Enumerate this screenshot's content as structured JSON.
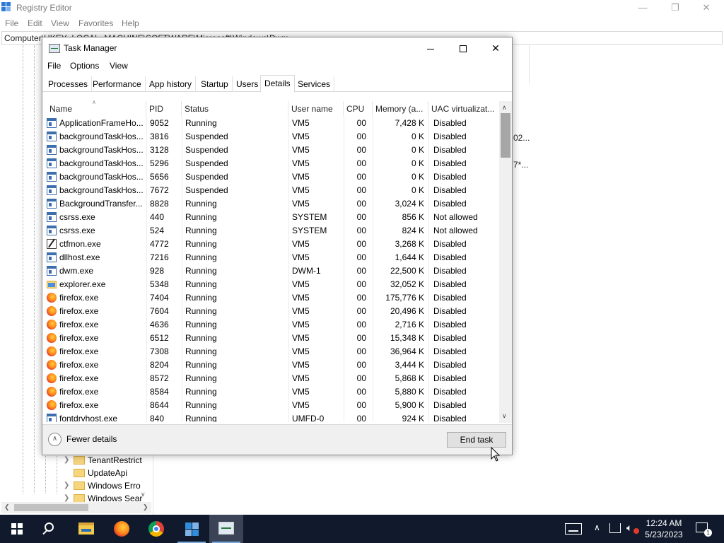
{
  "registry_editor": {
    "title": "Registry Editor",
    "menu": [
      "File",
      "Edit",
      "View",
      "Favorites",
      "Help"
    ],
    "address": "Computer\\HKEY_LOCAL_MACHINE\\SOFTWARE\\Microsoft\\Windows\\Dwm",
    "tree_items": [
      "TenantRestrict",
      "UpdateApi",
      "Windows Erro",
      "Windows Sear"
    ],
    "right_fragments": [
      "02...",
      "7*..."
    ],
    "window_buttons": [
      "—",
      "❐",
      "✕"
    ]
  },
  "task_manager": {
    "title": "Task Manager",
    "menu": [
      "File",
      "Options",
      "View"
    ],
    "tabs": [
      "Processes",
      "Performance",
      "App history",
      "Startup",
      "Users",
      "Details",
      "Services"
    ],
    "active_tab": "Details",
    "columns": [
      "Name",
      "PID",
      "Status",
      "User name",
      "CPU",
      "Memory (a...",
      "UAC virtualizat..."
    ],
    "rows": [
      {
        "icon": "exe",
        "name": "ApplicationFrameHo...",
        "pid": "9052",
        "status": "Running",
        "user": "VM5",
        "cpu": "00",
        "mem": "7,428 K",
        "uac": "Disabled"
      },
      {
        "icon": "exe",
        "name": "backgroundTaskHos...",
        "pid": "3816",
        "status": "Suspended",
        "user": "VM5",
        "cpu": "00",
        "mem": "0 K",
        "uac": "Disabled"
      },
      {
        "icon": "exe",
        "name": "backgroundTaskHos...",
        "pid": "3128",
        "status": "Suspended",
        "user": "VM5",
        "cpu": "00",
        "mem": "0 K",
        "uac": "Disabled"
      },
      {
        "icon": "exe",
        "name": "backgroundTaskHos...",
        "pid": "5296",
        "status": "Suspended",
        "user": "VM5",
        "cpu": "00",
        "mem": "0 K",
        "uac": "Disabled"
      },
      {
        "icon": "exe",
        "name": "backgroundTaskHos...",
        "pid": "5656",
        "status": "Suspended",
        "user": "VM5",
        "cpu": "00",
        "mem": "0 K",
        "uac": "Disabled"
      },
      {
        "icon": "exe",
        "name": "backgroundTaskHos...",
        "pid": "7672",
        "status": "Suspended",
        "user": "VM5",
        "cpu": "00",
        "mem": "0 K",
        "uac": "Disabled"
      },
      {
        "icon": "exe",
        "name": "BackgroundTransfer...",
        "pid": "8828",
        "status": "Running",
        "user": "VM5",
        "cpu": "00",
        "mem": "3,024 K",
        "uac": "Disabled"
      },
      {
        "icon": "exe",
        "name": "csrss.exe",
        "pid": "440",
        "status": "Running",
        "user": "SYSTEM",
        "cpu": "00",
        "mem": "856 K",
        "uac": "Not allowed"
      },
      {
        "icon": "exe",
        "name": "csrss.exe",
        "pid": "524",
        "status": "Running",
        "user": "SYSTEM",
        "cpu": "00",
        "mem": "824 K",
        "uac": "Not allowed"
      },
      {
        "icon": "pen",
        "name": "ctfmon.exe",
        "pid": "4772",
        "status": "Running",
        "user": "VM5",
        "cpu": "00",
        "mem": "3,268 K",
        "uac": "Disabled"
      },
      {
        "icon": "exe",
        "name": "dllhost.exe",
        "pid": "7216",
        "status": "Running",
        "user": "VM5",
        "cpu": "00",
        "mem": "1,644 K",
        "uac": "Disabled"
      },
      {
        "icon": "exe",
        "name": "dwm.exe",
        "pid": "928",
        "status": "Running",
        "user": "DWM-1",
        "cpu": "00",
        "mem": "22,500 K",
        "uac": "Disabled"
      },
      {
        "icon": "folder",
        "name": "explorer.exe",
        "pid": "5348",
        "status": "Running",
        "user": "VM5",
        "cpu": "00",
        "mem": "32,052 K",
        "uac": "Disabled"
      },
      {
        "icon": "firefox",
        "name": "firefox.exe",
        "pid": "7404",
        "status": "Running",
        "user": "VM5",
        "cpu": "00",
        "mem": "175,776 K",
        "uac": "Disabled"
      },
      {
        "icon": "firefox",
        "name": "firefox.exe",
        "pid": "7604",
        "status": "Running",
        "user": "VM5",
        "cpu": "00",
        "mem": "20,496 K",
        "uac": "Disabled"
      },
      {
        "icon": "firefox",
        "name": "firefox.exe",
        "pid": "4636",
        "status": "Running",
        "user": "VM5",
        "cpu": "00",
        "mem": "2,716 K",
        "uac": "Disabled"
      },
      {
        "icon": "firefox",
        "name": "firefox.exe",
        "pid": "6512",
        "status": "Running",
        "user": "VM5",
        "cpu": "00",
        "mem": "15,348 K",
        "uac": "Disabled"
      },
      {
        "icon": "firefox",
        "name": "firefox.exe",
        "pid": "7308",
        "status": "Running",
        "user": "VM5",
        "cpu": "00",
        "mem": "36,964 K",
        "uac": "Disabled"
      },
      {
        "icon": "firefox",
        "name": "firefox.exe",
        "pid": "8204",
        "status": "Running",
        "user": "VM5",
        "cpu": "00",
        "mem": "3,444 K",
        "uac": "Disabled"
      },
      {
        "icon": "firefox",
        "name": "firefox.exe",
        "pid": "8572",
        "status": "Running",
        "user": "VM5",
        "cpu": "00",
        "mem": "5,868 K",
        "uac": "Disabled"
      },
      {
        "icon": "firefox",
        "name": "firefox.exe",
        "pid": "8584",
        "status": "Running",
        "user": "VM5",
        "cpu": "00",
        "mem": "5,880 K",
        "uac": "Disabled"
      },
      {
        "icon": "firefox",
        "name": "firefox.exe",
        "pid": "8644",
        "status": "Running",
        "user": "VM5",
        "cpu": "00",
        "mem": "5,900 K",
        "uac": "Disabled"
      },
      {
        "icon": "exe",
        "name": "fontdrvhost.exe",
        "pid": "840",
        "status": "Running",
        "user": "UMFD-0",
        "cpu": "00",
        "mem": "924 K",
        "uac": "Disabled"
      }
    ],
    "footer": {
      "fewer_details": "Fewer details",
      "end_task": "End task"
    }
  },
  "taskbar": {
    "apps": [
      "start-icon",
      "search-icon",
      "file-explorer-icon",
      "firefox-icon",
      "chrome-icon",
      "registry-editor-icon",
      "task-manager-icon"
    ],
    "time": "12:24 AM",
    "date": "5/23/2023",
    "notification_count": "1"
  }
}
